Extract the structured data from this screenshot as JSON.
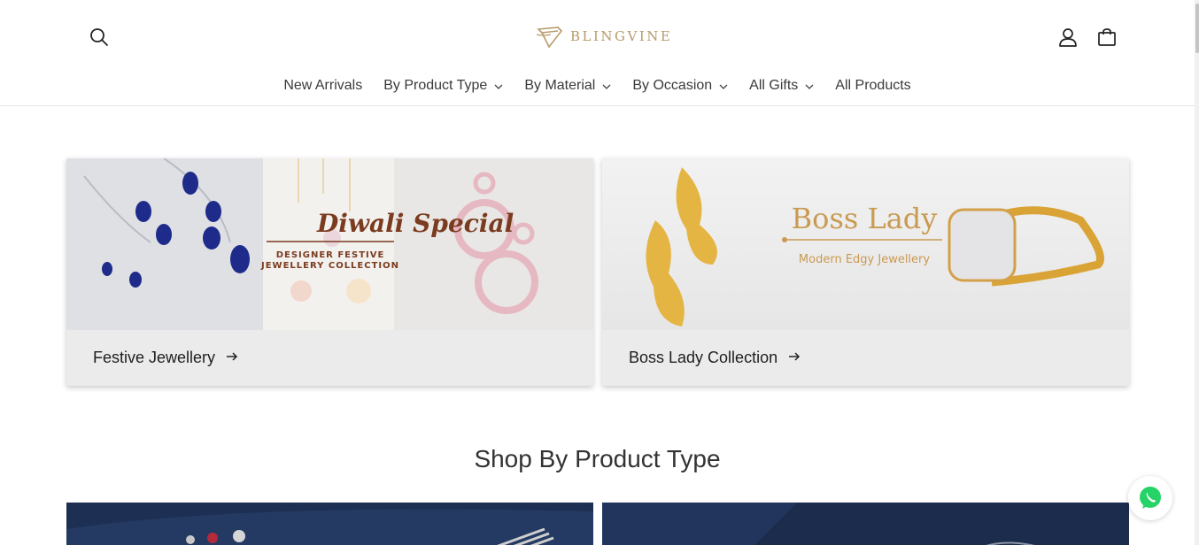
{
  "header": {
    "logo_text": "BLINGVINE",
    "icons": {
      "search": "search-icon",
      "account": "account-icon",
      "cart": "cart-icon"
    }
  },
  "nav": {
    "items": [
      {
        "label": "New Arrivals",
        "has_dropdown": false
      },
      {
        "label": "By Product Type",
        "has_dropdown": true
      },
      {
        "label": "By Material",
        "has_dropdown": true
      },
      {
        "label": "By Occasion",
        "has_dropdown": true
      },
      {
        "label": "All Gifts",
        "has_dropdown": true
      },
      {
        "label": "All Products",
        "has_dropdown": false
      }
    ]
  },
  "collections": [
    {
      "title": "Festive Jewellery",
      "banner_heading": "Diwali Special",
      "banner_sub1": "DESIGNER FESTIVE",
      "banner_sub2": "JEWELLERY COLLECTION"
    },
    {
      "title": "Boss Lady Collection",
      "banner_heading": "Boss Lady",
      "banner_sub": "Modern Edgy Jewellery"
    }
  ],
  "section": {
    "title": "Shop By Product Type"
  },
  "colors": {
    "brand_gold": "#b79a6a",
    "banner_brown": "#7a3b1f",
    "boss_gold": "#c99a52",
    "card_footer_bg": "#ebebeb",
    "whatsapp_green": "#25d366",
    "product_bg_navy": "#1d2f52"
  },
  "floating": {
    "whatsapp_icon": "whatsapp-icon"
  }
}
